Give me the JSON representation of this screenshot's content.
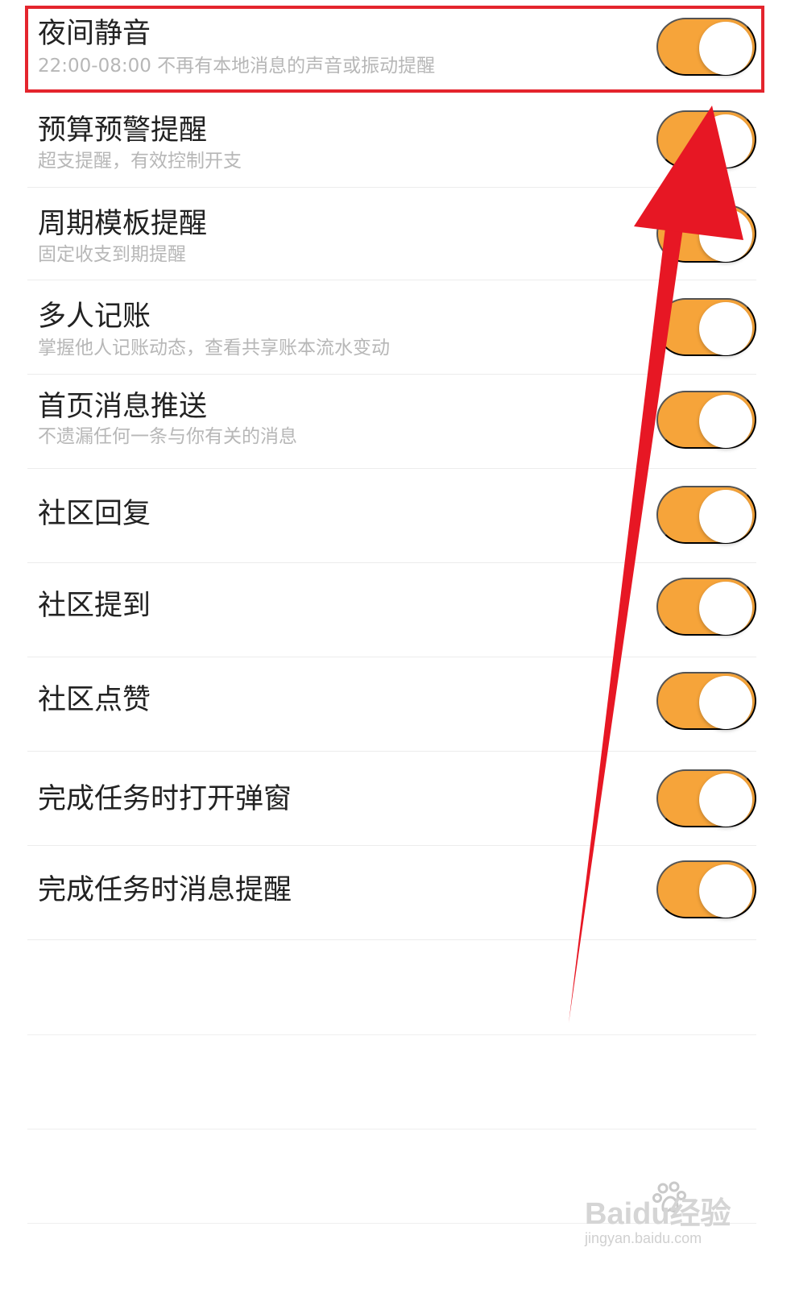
{
  "colors": {
    "toggle_on": "#f6a43a",
    "highlight": "#e4252d",
    "arrow": "#e71724"
  },
  "settings": [
    {
      "title": "夜间静音",
      "subtitle": "22:00-08:00 不再有本地消息的声音或振动提醒",
      "enabled": true
    },
    {
      "title": "预算预警提醒",
      "subtitle": "超支提醒，有效控制开支",
      "enabled": true
    },
    {
      "title": "周期模板提醒",
      "subtitle": "固定收支到期提醒",
      "enabled": true
    },
    {
      "title": "多人记账",
      "subtitle": "掌握他人记账动态，查看共享账本流水变动",
      "enabled": true
    },
    {
      "title": "首页消息推送",
      "subtitle": "不遗漏任何一条与你有关的消息",
      "enabled": true
    },
    {
      "title": "社区回复",
      "enabled": true
    },
    {
      "title": "社区提到",
      "enabled": true
    },
    {
      "title": "社区点赞",
      "enabled": true
    },
    {
      "title": "完成任务时打开弹窗",
      "enabled": true
    },
    {
      "title": "完成任务时消息提醒",
      "enabled": true
    }
  ],
  "watermark": {
    "brand": "Baidu经验",
    "domain": "jingyan.baidu.com",
    "icon": "paw-icon"
  }
}
